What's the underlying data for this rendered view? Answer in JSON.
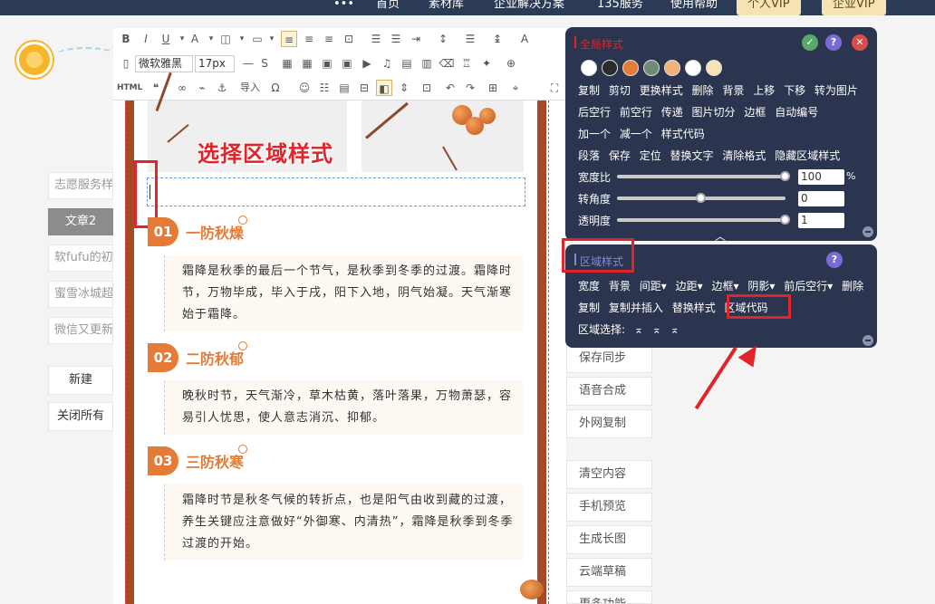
{
  "topnav": {
    "menu_icon": "•••",
    "items": [
      "首页",
      "素材库",
      "企业解决方案",
      "135服务",
      "使用帮助"
    ],
    "vip_personal": "个人VIP",
    "vip_enterprise": "企业VIP"
  },
  "left_panel": {
    "items": [
      "志愿服务样",
      "文章2",
      "软fufu的初",
      "蜜雪冰城超",
      "微信又更新"
    ],
    "new_button": "新建",
    "close_all_button": "关闭所有"
  },
  "toolbar": {
    "font_family": "微软雅黑",
    "font_size": "17px",
    "import_label": "导入",
    "html_label": "HTML"
  },
  "document": {
    "image_label": "选择区域样式",
    "sections": [
      {
        "num": "01",
        "title": "一防秋燥",
        "text": "霜降是秋季的最后一个节气，是秋季到冬季的过渡。霜降时节，万物毕成，毕入于戌，阳下入地，阴气始凝。天气渐寒始于霜降。"
      },
      {
        "num": "02",
        "title": "二防秋郁",
        "text": "晚秋时节，天气渐冷，草木枯黄，落叶落果，万物萧瑟，容易引人忧思，使人意志消沉、抑郁。"
      },
      {
        "num": "03",
        "title": "三防秋寒",
        "text": "霜降时节是秋冬气候的转折点，也是阳气由收到藏的过渡，养生关键应注意做好“外御寒、内清热”，霜降是秋季到冬季过渡的开始。"
      }
    ]
  },
  "global_panel": {
    "title": "全局样式",
    "swatch_colors": [
      "#ffffff",
      "#2b2b2b",
      "#e57b36",
      "#6e8a74",
      "#f0b27a",
      "#ffffff",
      "#f7e1b5"
    ],
    "row1": [
      "复制",
      "剪切",
      "更换样式",
      "删除",
      "背景",
      "上移",
      "下移",
      "转为图片"
    ],
    "row2": [
      "后空行",
      "前空行",
      "传递",
      "图片切分",
      "边框",
      "自动编号"
    ],
    "row3": [
      "加一个",
      "减一个",
      "样式代码"
    ],
    "row4": [
      "段落",
      "保存",
      "定位",
      "替换文字",
      "清除格式",
      "隐藏区域样式"
    ],
    "width_label": "宽度比",
    "width_value": "100",
    "width_unit": "%",
    "width_level": 1.0,
    "angle_label": "转角度",
    "angle_value": "0",
    "angle_level": 0.5,
    "opacity_label": "透明度",
    "opacity_value": "1",
    "opacity_level": 1.0,
    "collapse_glyph": "︿"
  },
  "region_panel": {
    "title": "区域样式",
    "row1": [
      "宽度",
      "背景",
      "间距",
      "边距",
      "边框",
      "阴影",
      "前后空行",
      "删除"
    ],
    "row1_dropdown_flags": [
      false,
      false,
      true,
      true,
      true,
      true,
      true,
      false
    ],
    "row2": [
      "复制",
      "复制并插入",
      "替换样式",
      "区域代码"
    ],
    "select_label": "区域选择:",
    "select_glyph": "⌅"
  },
  "side_buttons": [
    "保存同步",
    "语音合成",
    "外网复制",
    "清空内容",
    "手机预览",
    "生成长图",
    "云端草稿",
    "更多功能"
  ],
  "colors": {
    "accent_red": "#e0242a",
    "orange": "#e57b36",
    "panel_bg": "#2b3550",
    "nav_bg": "#2b3a55"
  }
}
